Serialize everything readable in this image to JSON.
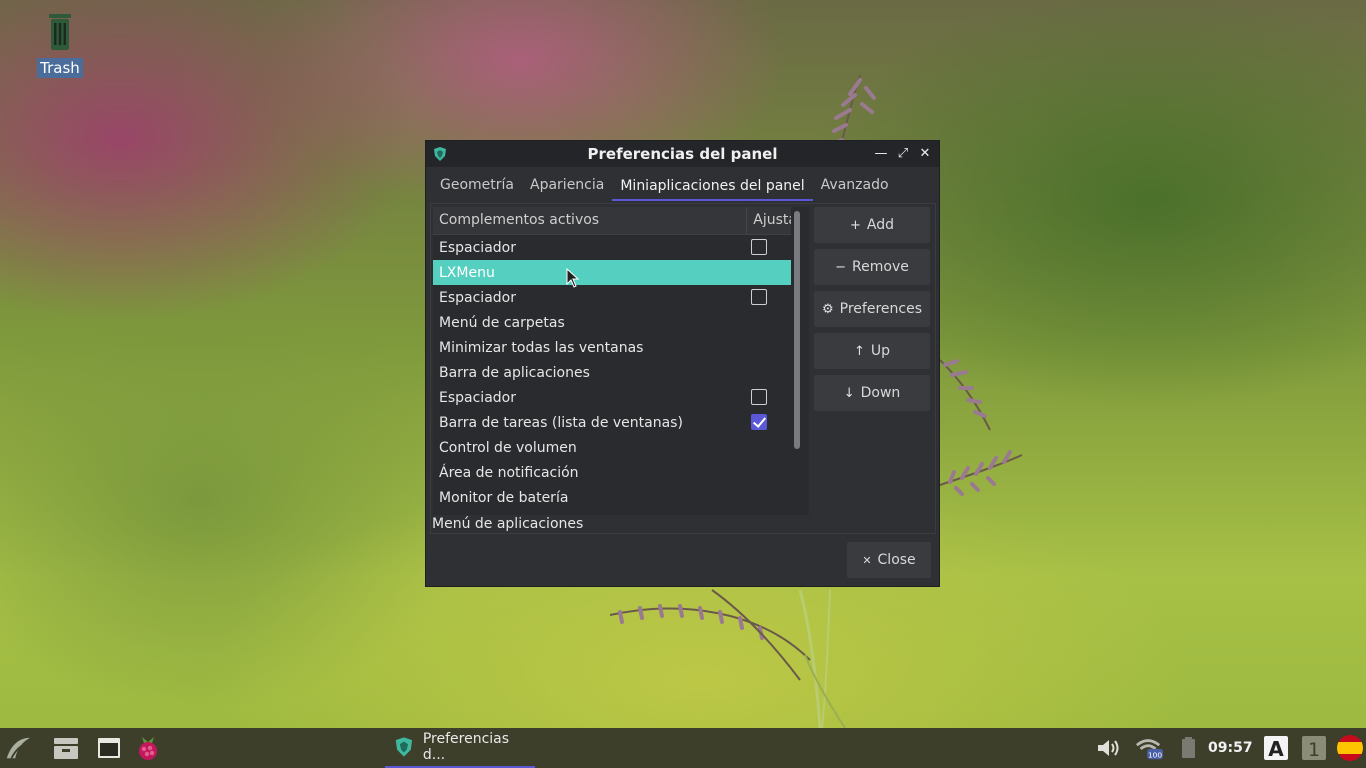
{
  "desktop": {
    "icons": [
      {
        "label": "Trash",
        "icon": "trash-icon"
      }
    ]
  },
  "window": {
    "title": "Preferencias del panel",
    "tabs": [
      {
        "label": "Geometría",
        "active": false
      },
      {
        "label": "Apariencia",
        "active": false
      },
      {
        "label": "Miniaplicaciones del panel",
        "active": true
      },
      {
        "label": "Avanzado",
        "active": false
      }
    ],
    "list": {
      "headers": {
        "name": "Complementos activos",
        "adjust": "Ajustar"
      },
      "rows": [
        {
          "name": "Espaciador",
          "checkbox": true,
          "checked": false,
          "selected": false
        },
        {
          "name": "LXMenu",
          "checkbox": false,
          "checked": false,
          "selected": true
        },
        {
          "name": "Espaciador",
          "checkbox": true,
          "checked": false,
          "selected": false
        },
        {
          "name": "Menú de carpetas",
          "checkbox": false,
          "checked": false,
          "selected": false
        },
        {
          "name": "Minimizar todas las ventanas",
          "checkbox": false,
          "checked": false,
          "selected": false
        },
        {
          "name": "Barra de aplicaciones",
          "checkbox": false,
          "checked": false,
          "selected": false
        },
        {
          "name": "Espaciador",
          "checkbox": true,
          "checked": false,
          "selected": false
        },
        {
          "name": "Barra de tareas (lista de ventanas)",
          "checkbox": true,
          "checked": true,
          "selected": false
        },
        {
          "name": "Control de volumen",
          "checkbox": false,
          "checked": false,
          "selected": false
        },
        {
          "name": "Área de notificación",
          "checkbox": false,
          "checked": false,
          "selected": false
        },
        {
          "name": "Monitor de batería",
          "checkbox": false,
          "checked": false,
          "selected": false
        }
      ]
    },
    "status_text": "Menú de aplicaciones",
    "buttons": {
      "add": "Add",
      "remove": "Remove",
      "preferences": "Preferences",
      "up": "Up",
      "down": "Down",
      "close": "Close"
    }
  },
  "taskbar": {
    "task_label": "Preferencias d...",
    "clock": "09:57",
    "keyboard_layout": "A",
    "workspace": "1",
    "network_badge": "100"
  },
  "colors": {
    "accent": "#5a58d6",
    "selection": "#55d0c0",
    "window_bg": "#2f3033",
    "titlebar": "#242528",
    "taskbar": "#3d3f2a"
  }
}
